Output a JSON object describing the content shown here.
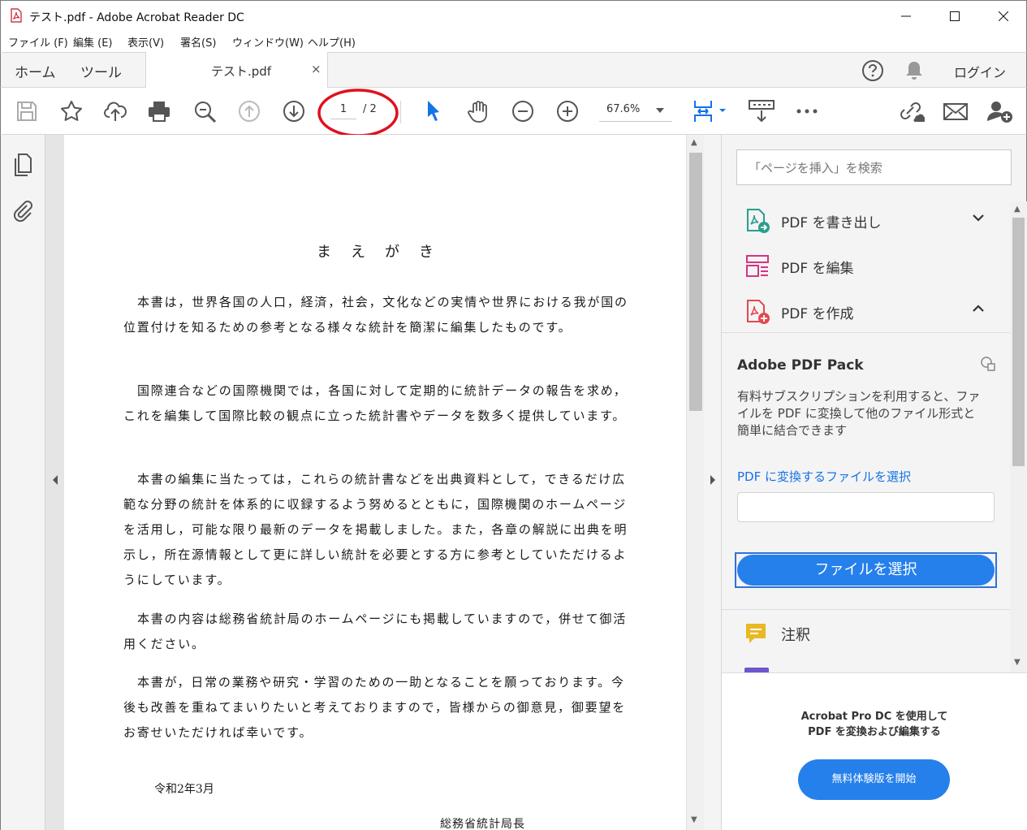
{
  "window": {
    "title": "テスト.pdf - Adobe Acrobat Reader DC"
  },
  "menu": {
    "items": [
      "ファイル (F)",
      "編集 (E)",
      "表示(V)",
      "署名(S)",
      "ウィンドウ(W)",
      "ヘルプ(H)"
    ]
  },
  "tabs": {
    "home": "ホーム",
    "tools": "ツール",
    "document": "テスト.pdf",
    "close": "×",
    "login": "ログイン"
  },
  "toolbar": {
    "current_page": "1",
    "total_pages": "/ 2",
    "zoom": "67.6%"
  },
  "document": {
    "heading": "まえがき",
    "paragraphs": [
      "本書は，世界各国の人口，経済，社会，文化などの実情や世界における我が国の位置付けを知るための参考となる様々な統計を簡潔に編集したものです。",
      "国際連合などの国際機関では，各国に対して定期的に統計データの報告を求め，これを編集して国際比較の観点に立った統計書やデータを数多く提供しています。",
      "本書の編集に当たっては，これらの統計書などを出典資料として，できるだけ広範な分野の統計を体系的に収録するよう努めるとともに，国際機関のホームページを活用し，可能な限り最新のデータを掲載しました。また，各章の解説に出典を明示し，所在源情報として更に詳しい統計を必要とする方に参考としていただけるようにしています。",
      "本書の内容は総務省統計局のホームページにも掲載していますので，併せて御活用ください。",
      "本書が，日常の業務や研究・学習のための一助となることを願っております。今後も改善を重ねてまいりたいと考えておりますので，皆様からの御意見，御要望をお寄せいただければ幸いです。"
    ],
    "date": "令和2年3月",
    "signature": "総務省統計局長"
  },
  "rightpane": {
    "search_placeholder": "「ページを挿入」を検索",
    "tools": {
      "export": "PDF を書き出し",
      "edit": "PDF を編集",
      "create": "PDF を作成",
      "comment": "注釈"
    },
    "pack": {
      "title": "Adobe PDF Pack",
      "description": "有料サブスクリプションを利用すると、ファイルを PDF に変換して他のファイル形式と簡単に結合できます",
      "link": "PDF に変換するファイルを選択",
      "button": "ファイルを選択"
    },
    "promo": {
      "line1": "Acrobat Pro DC を使用して",
      "line2": "PDF を変換および編集する",
      "button": "無料体験版を開始"
    }
  },
  "colors": {
    "accent": "#2680eb",
    "annotation": "#e0101e",
    "link": "#1473e6"
  }
}
